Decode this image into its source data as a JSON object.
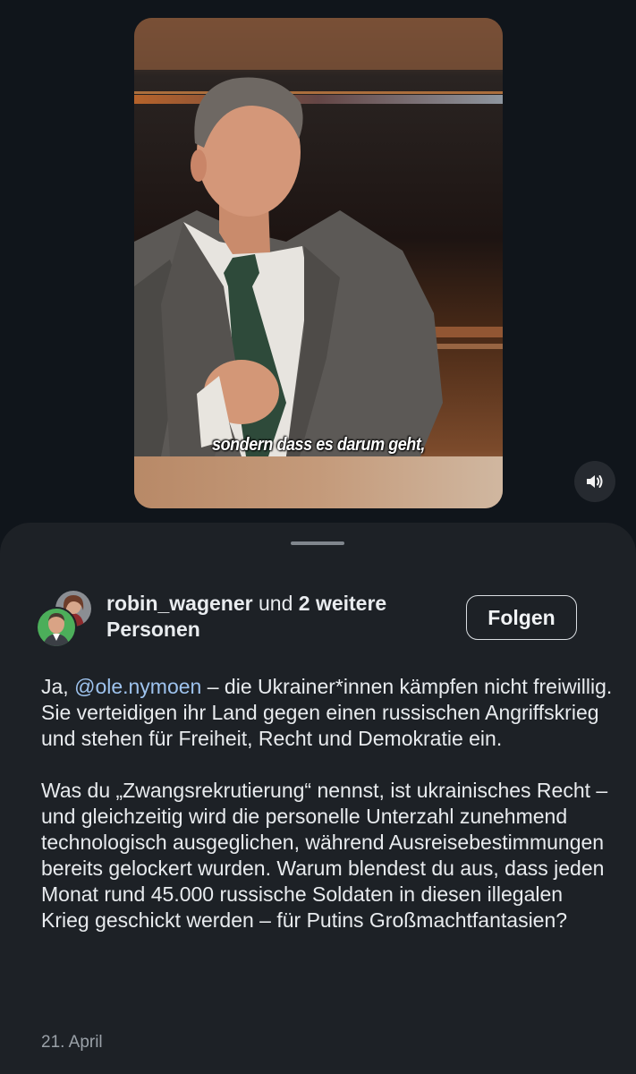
{
  "video": {
    "caption": "sondern dass es darum geht,",
    "sound_icon": "speaker-icon"
  },
  "post": {
    "author_primary": "robin_wagener",
    "author_joiner": "und",
    "author_others": "2 weitere Personen",
    "follow_label": "Folgen",
    "mention_symbol": "@",
    "mention": "ole.nymoen",
    "paragraph1_after_mention": "– die Ukrainer*innen kämpfen nicht freiwillig. Sie verteidigen ihr Land gegen einen russischen Angriffskrieg und stehen für Freiheit, Recht und Demokratie ein.",
    "paragraph1_before_mention": "Ja,",
    "paragraph2": "Was du „Zwangsrekrutierung“ nennst, ist ukrainisches Recht – und gleichzeitig wird die personelle Unterzahl zunehmend technologisch ausgeglichen, während Ausreisebestimmungen bereits gelockert wurden. Warum blendest du aus, dass jeden Monat rund 45.000 russische Soldaten in diesen illegalen Krieg geschickt werden – für Putins Großmachtfantasien?",
    "date": "21. April"
  },
  "colors": {
    "background": "#10151b",
    "sheet": "#1d2126",
    "mention": "#9ec3ee",
    "text": "#e8ebee"
  }
}
